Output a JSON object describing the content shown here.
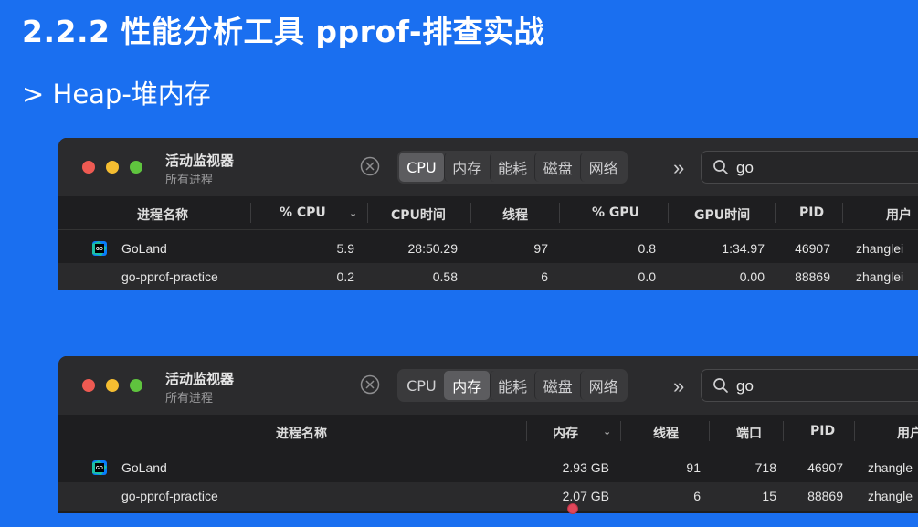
{
  "slide": {
    "title": "2.2.2 性能分析工具 pprof-排查实战",
    "subtitle": "> Heap-堆内存"
  },
  "window1": {
    "app_title": "活动监视器",
    "app_subtitle": "所有进程",
    "tabs": [
      {
        "label": "CPU",
        "active": true
      },
      {
        "label": "内存",
        "active": false
      },
      {
        "label": "能耗",
        "active": false
      },
      {
        "label": "磁盘",
        "active": false
      },
      {
        "label": "网络",
        "active": false
      }
    ],
    "overflow_label": "»",
    "search": {
      "value": "go"
    },
    "columns": [
      "进程名称",
      "% CPU",
      "CPU时间",
      "线程",
      "% GPU",
      "GPU时间",
      "PID",
      "用户"
    ],
    "rows": [
      {
        "name": "GoLand",
        "cpu": "5.9",
        "cpu_time": "28:50.29",
        "threads": "97",
        "gpu": "0.8",
        "gpu_time": "1:34.97",
        "pid": "46907",
        "user": "zhanglei",
        "icon": "goland-icon"
      },
      {
        "name": "go-pprof-practice",
        "cpu": "0.2",
        "cpu_time": "0.58",
        "threads": "6",
        "gpu": "0.0",
        "gpu_time": "0.00",
        "pid": "88869",
        "user": "zhanglei"
      }
    ]
  },
  "window2": {
    "app_title": "活动监视器",
    "app_subtitle": "所有进程",
    "tabs": [
      {
        "label": "CPU",
        "active": false
      },
      {
        "label": "内存",
        "active": true
      },
      {
        "label": "能耗",
        "active": false
      },
      {
        "label": "磁盘",
        "active": false
      },
      {
        "label": "网络",
        "active": false
      }
    ],
    "overflow_label": "»",
    "search": {
      "value": "go"
    },
    "columns": [
      "进程名称",
      "内存",
      "线程",
      "端口",
      "PID",
      "用户"
    ],
    "rows": [
      {
        "name": "GoLand",
        "memory": "2.93 GB",
        "threads": "91",
        "ports": "718",
        "pid": "46907",
        "user": "zhangle",
        "icon": "goland-icon"
      },
      {
        "name": "go-pprof-practice",
        "memory": "2.07 GB",
        "threads": "6",
        "ports": "15",
        "pid": "88869",
        "user": "zhangle"
      }
    ]
  },
  "colors": {
    "background": "#1a6ff0",
    "window": "#1e1e20",
    "titlebar": "#2b2b2d",
    "row_alt": "#2a2a2c"
  }
}
